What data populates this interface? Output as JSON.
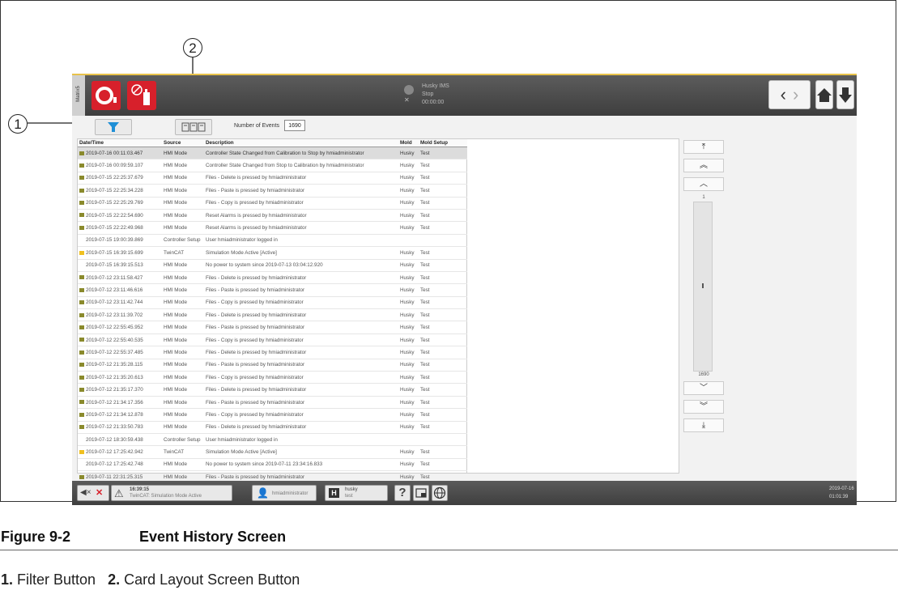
{
  "callouts": {
    "one": "1",
    "two": "2"
  },
  "screen": {
    "side_label": "Matrix5",
    "status": {
      "line1": "Husky IMS",
      "line2": "Stop",
      "line3": "00:00:00"
    },
    "toolbar": {
      "events_label": "Number of Events",
      "events_count": "1690"
    },
    "table": {
      "headers": [
        "Date/Time",
        "Source",
        "Description",
        "Mold",
        "Mold Setup"
      ],
      "rows": [
        {
          "sev": "flag",
          "dt": "2019-07-16 00:11:03.467",
          "src": "HMI Mode",
          "desc": "Controller State Changed from Calibration to Stop  by hmiadministrator",
          "mold": "Husky",
          "setup": "Test"
        },
        {
          "sev": "flag",
          "dt": "2019-07-16 00:09:59.107",
          "src": "HMI Mode",
          "desc": "Controller State Changed from Stop to Calibration  by hmiadministrator",
          "mold": "Husky",
          "setup": "Test"
        },
        {
          "sev": "flag",
          "dt": "2019-07-15 22:25:37.679",
          "src": "HMI Mode",
          "desc": "Files - Delete is pressed by hmiadministrator",
          "mold": "Husky",
          "setup": "Test"
        },
        {
          "sev": "flag",
          "dt": "2019-07-15 22:25:34.228",
          "src": "HMI Mode",
          "desc": "Files - Paste is pressed by hmiadministrator",
          "mold": "Husky",
          "setup": "Test"
        },
        {
          "sev": "flag",
          "dt": "2019-07-15 22:25:29.769",
          "src": "HMI Mode",
          "desc": "Files - Copy is pressed by hmiadministrator",
          "mold": "Husky",
          "setup": "Test"
        },
        {
          "sev": "flag",
          "dt": "2019-07-15 22:22:54.690",
          "src": "HMI Mode",
          "desc": "Reset Alarms is pressed by hmiadministrator",
          "mold": "Husky",
          "setup": "Test"
        },
        {
          "sev": "flag",
          "dt": "2019-07-15 22:22:49.968",
          "src": "HMI Mode",
          "desc": "Reset Alarms is pressed by hmiadministrator",
          "mold": "Husky",
          "setup": "Test"
        },
        {
          "sev": "none",
          "dt": "2019-07-15 19:00:39.869",
          "src": "Controller Setup",
          "desc": "User hmiadministrator logged in",
          "mold": "",
          "setup": ""
        },
        {
          "sev": "warn",
          "dt": "2019-07-15 16:39:15.699",
          "src": "TwinCAT",
          "desc": "Simulation Mode Active [Active]",
          "mold": "Husky",
          "setup": "Test"
        },
        {
          "sev": "none",
          "dt": "2019-07-15 16:39:15.513",
          "src": "HMI Mode",
          "desc": "No power to system since 2019-07-13 03:04:12.920",
          "mold": "Husky",
          "setup": "Test"
        },
        {
          "sev": "flag",
          "dt": "2019-07-12 23:11:58.427",
          "src": "HMI Mode",
          "desc": "Files - Delete is pressed by hmiadministrator",
          "mold": "Husky",
          "setup": "Test"
        },
        {
          "sev": "flag",
          "dt": "2019-07-12 23:11:46.616",
          "src": "HMI Mode",
          "desc": "Files - Paste is pressed by hmiadministrator",
          "mold": "Husky",
          "setup": "Test"
        },
        {
          "sev": "flag",
          "dt": "2019-07-12 23:11:42.744",
          "src": "HMI Mode",
          "desc": "Files - Copy is pressed by hmiadministrator",
          "mold": "Husky",
          "setup": "Test"
        },
        {
          "sev": "flag",
          "dt": "2019-07-12 23:11:39.702",
          "src": "HMI Mode",
          "desc": "Files - Delete is pressed by hmiadministrator",
          "mold": "Husky",
          "setup": "Test"
        },
        {
          "sev": "flag",
          "dt": "2019-07-12 22:55:45.952",
          "src": "HMI Mode",
          "desc": "Files - Paste is pressed by hmiadministrator",
          "mold": "Husky",
          "setup": "Test"
        },
        {
          "sev": "flag",
          "dt": "2019-07-12 22:55:40.535",
          "src": "HMI Mode",
          "desc": "Files - Copy is pressed by hmiadministrator",
          "mold": "Husky",
          "setup": "Test"
        },
        {
          "sev": "flag",
          "dt": "2019-07-12 22:55:37.485",
          "src": "HMI Mode",
          "desc": "Files - Delete is pressed by hmiadministrator",
          "mold": "Husky",
          "setup": "Test"
        },
        {
          "sev": "flag",
          "dt": "2019-07-12 21:35:28.115",
          "src": "HMI Mode",
          "desc": "Files - Paste is pressed by hmiadministrator",
          "mold": "Husky",
          "setup": "Test"
        },
        {
          "sev": "flag",
          "dt": "2019-07-12 21:35:20.613",
          "src": "HMI Mode",
          "desc": "Files - Copy is pressed by hmiadministrator",
          "mold": "Husky",
          "setup": "Test"
        },
        {
          "sev": "flag",
          "dt": "2019-07-12 21:35:17.370",
          "src": "HMI Mode",
          "desc": "Files - Delete is pressed by hmiadministrator",
          "mold": "Husky",
          "setup": "Test"
        },
        {
          "sev": "flag",
          "dt": "2019-07-12 21:34:17.356",
          "src": "HMI Mode",
          "desc": "Files - Paste is pressed by hmiadministrator",
          "mold": "Husky",
          "setup": "Test"
        },
        {
          "sev": "flag",
          "dt": "2019-07-12 21:34:12.878",
          "src": "HMI Mode",
          "desc": "Files - Copy is pressed by hmiadministrator",
          "mold": "Husky",
          "setup": "Test"
        },
        {
          "sev": "flag",
          "dt": "2019-07-12 21:33:50.783",
          "src": "HMI Mode",
          "desc": "Files - Delete is pressed by hmiadministrator",
          "mold": "Husky",
          "setup": "Test"
        },
        {
          "sev": "none",
          "dt": "2019-07-12 18:30:59.438",
          "src": "Controller Setup",
          "desc": "User hmiadministrator logged in",
          "mold": "",
          "setup": ""
        },
        {
          "sev": "warn",
          "dt": "2019-07-12 17:25:42.942",
          "src": "TwinCAT",
          "desc": "Simulation Mode Active [Active]",
          "mold": "Husky",
          "setup": "Test"
        },
        {
          "sev": "none",
          "dt": "2019-07-12 17:25:42.748",
          "src": "HMI Mode",
          "desc": "No power to system since 2019-07-11 23:34:16.833",
          "mold": "Husky",
          "setup": "Test"
        },
        {
          "sev": "flag",
          "dt": "2019-07-11 22:31:25.315",
          "src": "HMI Mode",
          "desc": "Files - Paste is pressed by hmiadministrator",
          "mold": "Husky",
          "setup": "Test"
        }
      ]
    },
    "scroll": {
      "top_num": "1",
      "bottom_num": "1690"
    },
    "bottom": {
      "alarm_time": "16:39:15",
      "alarm_text": "TwinCAT: Simulation Mode Active",
      "user": "hmiadministrator",
      "mold_name": "husky",
      "mold_setup": "test",
      "date": "2019-07-16",
      "time": "01:01:39"
    }
  },
  "caption": {
    "figure": "Figure 9-2",
    "title": "Event History Screen",
    "legend_1_num": "1.",
    "legend_1_text": "Filter Button",
    "legend_2_num": "2.",
    "legend_2_text": "Card Layout Screen Button"
  },
  "colors": {
    "accent_red": "#d7202b",
    "topbar": "#4a4a4a",
    "filter_blue": "#1f8fd6"
  }
}
